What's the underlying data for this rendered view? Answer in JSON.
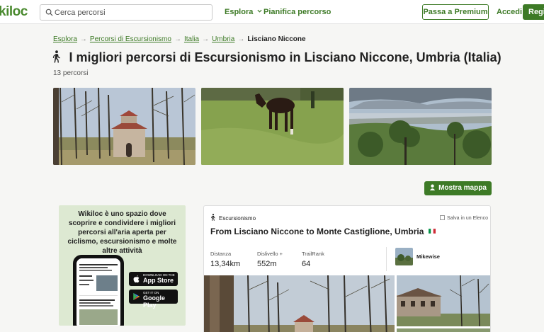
{
  "header": {
    "logo": "kiloc",
    "search_placeholder": "Cerca percorsi",
    "explore_label": "Esplora",
    "plan_label": "Pianifica percorso",
    "premium_label": "Passa a Premium",
    "login_label": "Accedi",
    "register_label": "Regi"
  },
  "breadcrumb": {
    "items": [
      "Esplora",
      "Percorsi di Escursionismo",
      "Italia",
      "Umbria"
    ],
    "current": "Lisciano Niccone",
    "separator": "→"
  },
  "page": {
    "title": "I migliori percorsi di Escursionismo in Lisciano Niccone, Umbria (Italia)",
    "count": "13 percorsi",
    "map_button": "Mostra mappa"
  },
  "promo": {
    "text": "Wikiloc è uno spazio dove scoprire e condividere i migliori percorsi all'aria aperta per ciclismo, escursionismo e molte altre attività",
    "appstore_small": "Download on the",
    "appstore_big": "App Store",
    "gplay_small": "GET IT ON",
    "gplay_big": "Google Play"
  },
  "trail": {
    "activity": "Escursionismo",
    "save_label": "Salva in un Elenco",
    "title": "From Lisciano Niccone to Monte Castiglione, Umbria",
    "stats": [
      {
        "label": "Distanza",
        "value": "13,34km"
      },
      {
        "label": "Dislivello +",
        "value": "552m"
      },
      {
        "label": "TrailRank",
        "value": "64"
      }
    ],
    "author": "Mikewise"
  },
  "colors": {
    "brand_green": "#3d7a26",
    "background": "#f6f6f4",
    "promo_bg": "#dde9d2"
  }
}
